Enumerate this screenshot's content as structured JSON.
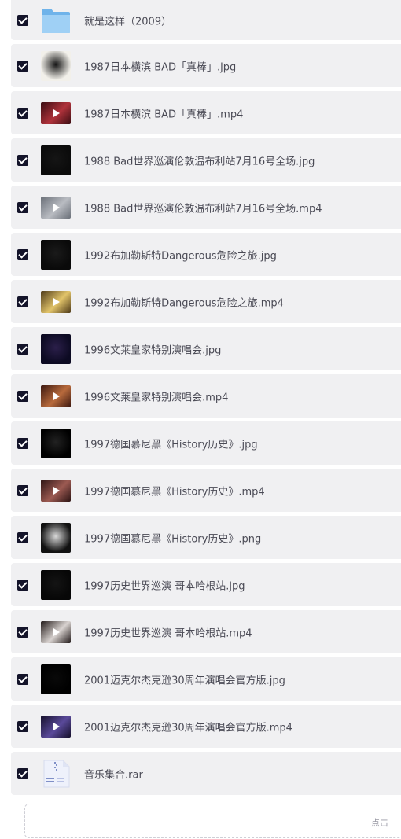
{
  "files": [
    {
      "name": "就是这样（2009）",
      "kind": "folder",
      "checked": true,
      "colors": [
        "#9fd0f5",
        "#6fb3ea"
      ]
    },
    {
      "name": "1987日本横滨 BAD「真棒」.jpg",
      "kind": "image",
      "checked": true,
      "colors": [
        "#f2f0ea",
        "#151515"
      ]
    },
    {
      "name": "1987日本横滨 BAD「真棒」.mp4",
      "kind": "video",
      "checked": true,
      "colors": [
        "#3a0d12",
        "#b0323b"
      ]
    },
    {
      "name": "1988 Bad世界巡演伦敦温布利站7月16号全场.jpg",
      "kind": "image",
      "checked": true,
      "colors": [
        "#0b0b0b",
        "#151515"
      ]
    },
    {
      "name": "1988 Bad世界巡演伦敦温布利站7月16号全场.mp4",
      "kind": "video",
      "checked": true,
      "colors": [
        "#6a6f78",
        "#b9bcc2"
      ]
    },
    {
      "name": "1992布加勒斯特Dangerous危险之旅.jpg",
      "kind": "image",
      "checked": true,
      "colors": [
        "#0a0a0a",
        "#1a1a1a"
      ]
    },
    {
      "name": "1992布加勒斯特Dangerous危险之旅.mp4",
      "kind": "video",
      "checked": true,
      "colors": [
        "#4e3a18",
        "#e2c46a"
      ]
    },
    {
      "name": "1996文莱皇家特别演唱会.jpg",
      "kind": "image",
      "checked": true,
      "colors": [
        "#0c0a22",
        "#2b1f4a"
      ]
    },
    {
      "name": "1996文莱皇家特别演唱会.mp4",
      "kind": "video",
      "checked": true,
      "colors": [
        "#3c1810",
        "#b86a3c"
      ]
    },
    {
      "name": "1997德国慕尼黑《History历史》.jpg",
      "kind": "image",
      "checked": true,
      "colors": [
        "#000000",
        "#222222"
      ]
    },
    {
      "name": "1997德国慕尼黑《History历史》.mp4",
      "kind": "video",
      "checked": true,
      "colors": [
        "#2c1414",
        "#9c5a52"
      ]
    },
    {
      "name": "1997德国慕尼黑《History历史》.png",
      "kind": "image",
      "checked": true,
      "colors": [
        "#111111",
        "#d8d8d8"
      ]
    },
    {
      "name": "1997历史世界巡演 哥本哈根站.jpg",
      "kind": "image",
      "checked": true,
      "colors": [
        "#070707",
        "#141414"
      ]
    },
    {
      "name": "1997历史世界巡演 哥本哈根站.mp4",
      "kind": "video",
      "checked": true,
      "colors": [
        "#221a1a",
        "#d9d3d0"
      ]
    },
    {
      "name": "2001迈克尔杰克逊30周年演唱会官方版.jpg",
      "kind": "image",
      "checked": true,
      "colors": [
        "#000000",
        "#090909"
      ]
    },
    {
      "name": "2001迈克尔杰克逊30周年演唱会官方版.mp4",
      "kind": "video",
      "checked": true,
      "colors": [
        "#150f2a",
        "#5a4a9a"
      ]
    },
    {
      "name": "音乐集合.rar",
      "kind": "archive",
      "checked": true,
      "colors": [
        "#eef1fb",
        "#7f8fc7"
      ]
    }
  ],
  "upload": {
    "hint": "点击"
  },
  "icons": {
    "checkbox": "checkbox-checked-icon",
    "folder": "folder-icon",
    "archive": "archive-icon",
    "play": "play-icon"
  }
}
